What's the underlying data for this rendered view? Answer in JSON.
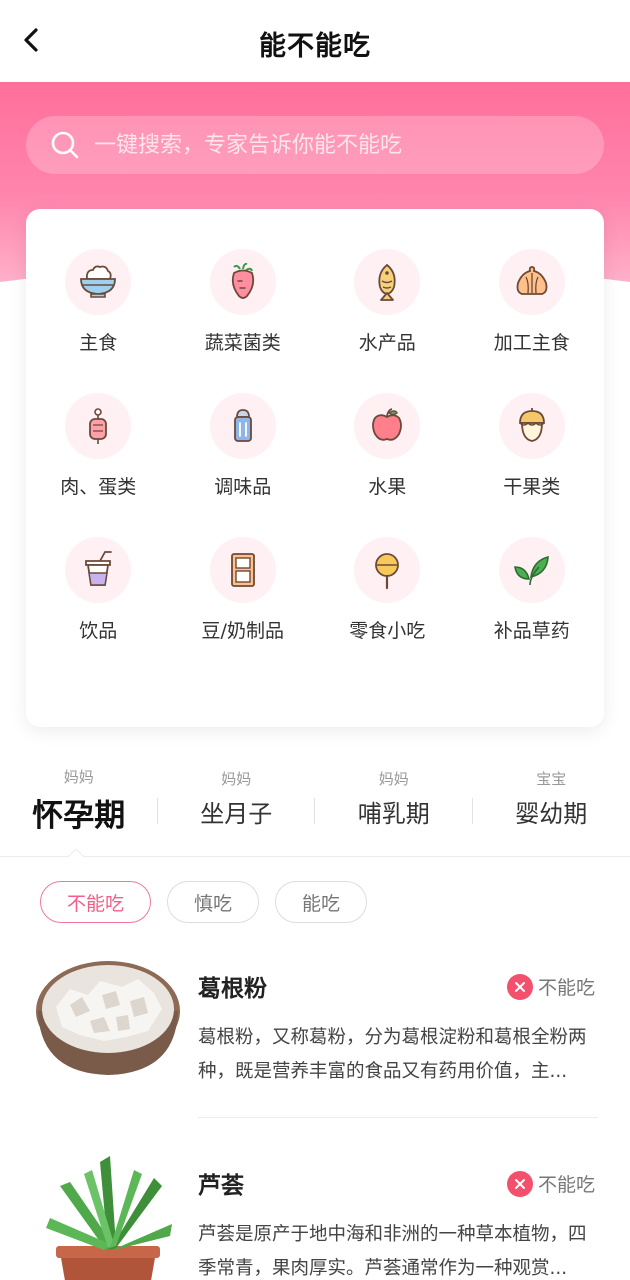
{
  "nav": {
    "title": "能不能吃",
    "back_icon": "chevron-left-icon"
  },
  "search": {
    "placeholder": "一键搜索，专家告诉你能不能吃",
    "icon": "search-icon"
  },
  "categories": [
    {
      "label": "主食",
      "icon": "rice-bowl-icon"
    },
    {
      "label": "蔬菜菌类",
      "icon": "vegetable-icon"
    },
    {
      "label": "水产品",
      "icon": "fish-icon"
    },
    {
      "label": "加工主食",
      "icon": "bun-icon"
    },
    {
      "label": "肉、蛋类",
      "icon": "meat-icon"
    },
    {
      "label": "调味品",
      "icon": "seasoning-shaker-icon"
    },
    {
      "label": "水果",
      "icon": "apple-icon"
    },
    {
      "label": "干果类",
      "icon": "nut-icon"
    },
    {
      "label": "饮品",
      "icon": "drink-cup-icon"
    },
    {
      "label": "豆/奶制品",
      "icon": "milk-carton-icon"
    },
    {
      "label": "零食小吃",
      "icon": "lollipop-icon"
    },
    {
      "label": "补品草药",
      "icon": "herb-leaf-icon"
    }
  ],
  "stages": [
    {
      "sub": "妈妈",
      "label": "怀孕期",
      "active": true
    },
    {
      "sub": "妈妈",
      "label": "坐月子",
      "active": false
    },
    {
      "sub": "妈妈",
      "label": "哺乳期",
      "active": false
    },
    {
      "sub": "宝宝",
      "label": "婴幼期",
      "active": false
    }
  ],
  "filters": [
    {
      "label": "不能吃",
      "active": true
    },
    {
      "label": "慎吃",
      "active": false
    },
    {
      "label": "能吃",
      "active": false
    }
  ],
  "items": [
    {
      "name": "葛根粉",
      "status": "不能吃",
      "desc": "葛根粉，又称葛粉，分为葛根淀粉和葛根全粉两种，既是营养丰富的食品又有药用价值，主..."
    },
    {
      "name": "芦荟",
      "status": "不能吃",
      "desc": "芦荟是原产于地中海和非洲的一种草本植物，四季常青，果肉厚实。芦荟通常作为一种观赏..."
    }
  ],
  "colors": {
    "accent": "#ff6f9c",
    "danger": "#f3506e"
  }
}
